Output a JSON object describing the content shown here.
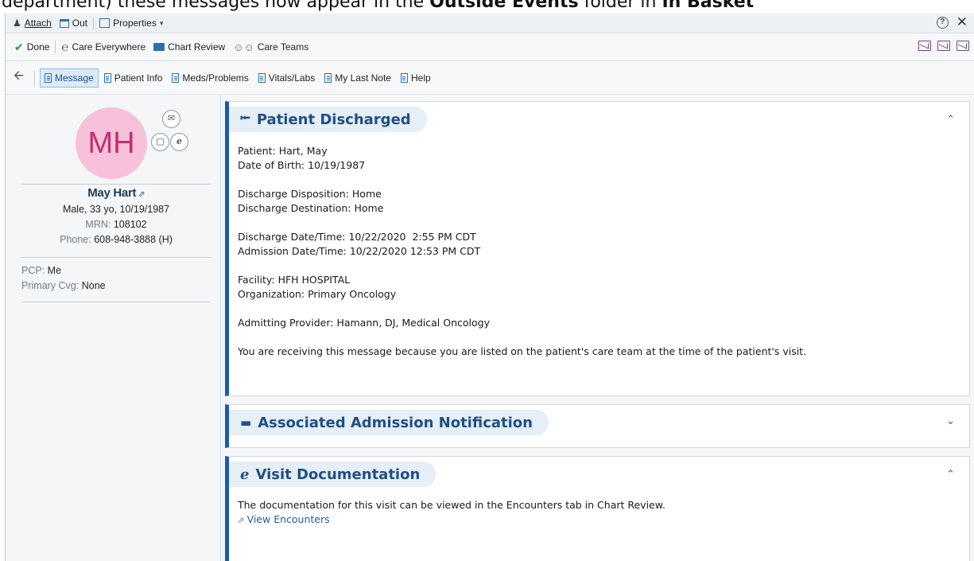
{
  "caption": {
    "part1": "department) these messages now appear in the ",
    "bold1": "Outside Events",
    "part2": " folder in ",
    "bold2": "In Basket"
  },
  "toolbar1": {
    "attach_label": "Attach",
    "out_label": "Out",
    "properties_label": "Properties",
    "help_glyph": "?",
    "close_glyph": "✕"
  },
  "toolbar2": {
    "done_label": "Done",
    "care_everywhere_label": "Care Everywhere",
    "chart_review_label": "Chart Review",
    "care_teams_label": "Care Teams"
  },
  "tabs": [
    {
      "label": "Message",
      "active": true
    },
    {
      "label": "Patient Info"
    },
    {
      "label": "Meds/Problems"
    },
    {
      "label": "Vitals/Labs"
    },
    {
      "label": "My Last Note"
    },
    {
      "label": "Help"
    }
  ],
  "patient": {
    "initials": "MH",
    "name": "May Hart",
    "demographics": "Male, 33 yo, 10/19/1987",
    "mrn_label": "MRN:",
    "mrn": "108102",
    "phone_label": "Phone:",
    "phone": "608-948-3888 (H)",
    "pcp_label": "PCP:",
    "pcp": "Me",
    "coverage_label": "Primary Cvg:",
    "coverage": "None"
  },
  "cards": {
    "discharged": {
      "title": "Patient Discharged",
      "patient_line": "Patient: Hart, May",
      "dob_line": "Date of Birth: 10/19/1987",
      "disposition_line": "Discharge Disposition: Home",
      "destination_line": "Discharge Destination: Home",
      "discharge_dt_line": "Discharge Date/Time: 10/22/2020  2:55 PM CDT",
      "admission_dt_line": "Admission Date/Time: 10/22/2020 12:53 PM CDT",
      "facility_line": "Facility: HFH HOSPITAL",
      "organization_line": "Organization: Primary Oncology",
      "provider_line": "Admitting Provider: Hamann, DJ, Medical Oncology",
      "reason_line": "You are receiving this message because you are listed on the patient's care team at the time of the patient's visit."
    },
    "admission": {
      "title": "Associated Admission Notification"
    },
    "visit": {
      "title": "Visit Documentation",
      "body": "The documentation for this visit can be viewed in the Encounters tab in Chart Review.",
      "link": "View Encounters"
    }
  },
  "colors": {
    "accent": "#1b5ca8",
    "avatar_bg": "#f7c1dc",
    "avatar_text": "#c0306e"
  }
}
